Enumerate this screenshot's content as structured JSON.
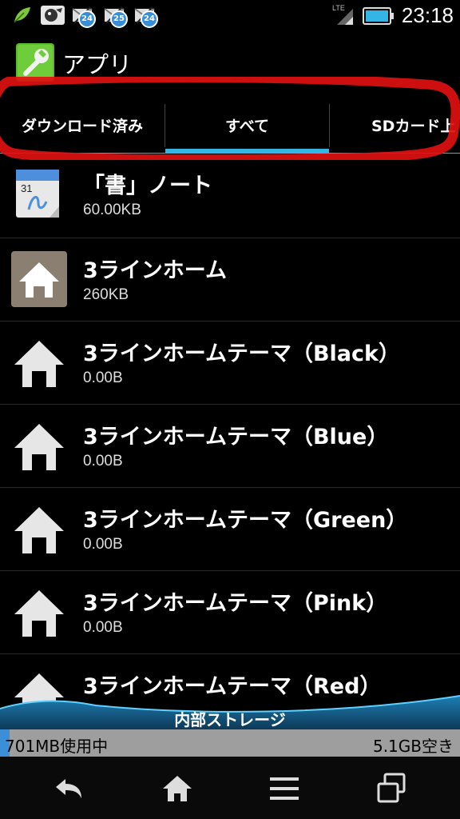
{
  "status_bar": {
    "time": "23:18",
    "network": "LTE",
    "notifications": [
      {
        "icon": "leaf-icon"
      },
      {
        "icon": "character-icon"
      },
      {
        "icon": "mail-icon",
        "badge": "24"
      },
      {
        "icon": "mail-icon",
        "badge": "25"
      },
      {
        "icon": "mail-icon",
        "badge": "24"
      }
    ],
    "battery_icon": "battery-icon"
  },
  "header": {
    "title": "アプリ",
    "icon": "wrench-icon"
  },
  "tabs": [
    {
      "label": "ダウンロード済み",
      "selected": false
    },
    {
      "label": "すべて",
      "selected": true
    },
    {
      "label": "SDカード上",
      "selected": false
    }
  ],
  "apps": [
    {
      "name": "「書」ノート",
      "size": "60.00KB",
      "icon": "notebook-icon"
    },
    {
      "name": "3ラインホーム",
      "size": "260KB",
      "icon": "home-tile-icon"
    },
    {
      "name": "3ラインホームテーマ（Black）",
      "size": "0.00B",
      "icon": "home-icon"
    },
    {
      "name": "3ラインホームテーマ（Blue）",
      "size": "0.00B",
      "icon": "home-icon"
    },
    {
      "name": "3ラインホームテーマ（Green）",
      "size": "0.00B",
      "icon": "home-icon"
    },
    {
      "name": "3ラインホームテーマ（Pink）",
      "size": "0.00B",
      "icon": "home-icon"
    },
    {
      "name": "3ラインホームテーマ（Red）",
      "size": "",
      "icon": "home-icon"
    }
  ],
  "storage": {
    "title": "内部ストレージ",
    "used": "701MB使用中",
    "free": "5.1GB空き"
  },
  "nav": {
    "back_icon": "back-icon",
    "home_icon": "home-nav-icon",
    "menu_icon": "menu-icon",
    "recents_icon": "recents-icon"
  },
  "colors": {
    "accent": "#33b5e5",
    "annotation": "#e01010",
    "storage_used": "#3b8fd6"
  }
}
